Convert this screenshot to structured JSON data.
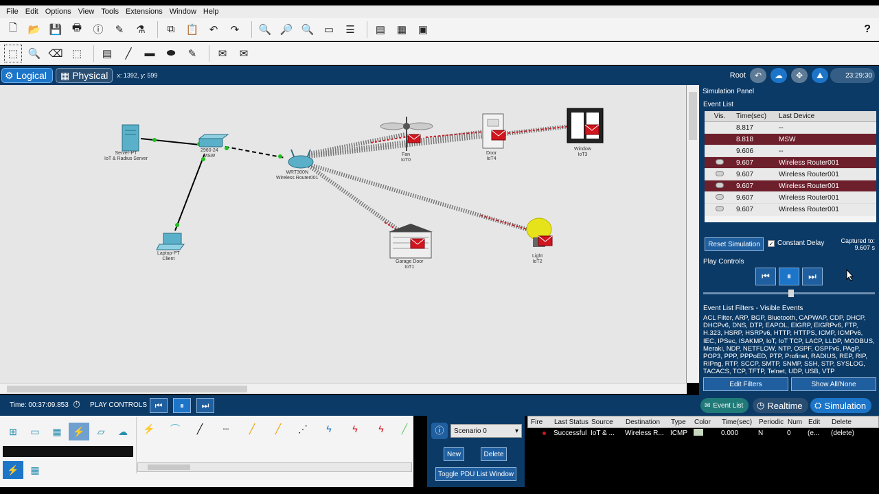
{
  "menu": [
    "File",
    "Edit",
    "Options",
    "View",
    "Tools",
    "Extensions",
    "Window",
    "Help"
  ],
  "viewbar": {
    "logical": "Logical",
    "physical": "Physical",
    "coords": "x: 1392, y: 599",
    "root": "Root",
    "clock": "23:29:30"
  },
  "devices": {
    "server": [
      "Server-PT",
      "IoT & Radius Server"
    ],
    "msw": [
      "2960-24",
      "MSW"
    ],
    "router": [
      "WRT300N",
      "Wireless Router001"
    ],
    "fan": [
      "Fan",
      "IoT0"
    ],
    "door": [
      "Door",
      "IoT4"
    ],
    "window": [
      "Window",
      "IoT3"
    ],
    "laptop": [
      "Laptop-PT",
      "Client"
    ],
    "garage": [
      "Garage Door",
      "IoT1"
    ],
    "light": [
      "Light",
      "IoT2"
    ]
  },
  "sim_panel": {
    "title": "Simulation Panel",
    "event_list": "Event List",
    "columns": [
      "Vis.",
      "Time(sec)",
      "Last Device"
    ],
    "events": [
      {
        "vis": false,
        "time": "8.817",
        "device": "--",
        "hl": false
      },
      {
        "vis": false,
        "time": "8.818",
        "device": "MSW",
        "hl": true
      },
      {
        "vis": false,
        "time": "9.606",
        "device": "--",
        "hl": false
      },
      {
        "vis": true,
        "time": "9.607",
        "device": "Wireless Router001",
        "hl": true
      },
      {
        "vis": true,
        "time": "9.607",
        "device": "Wireless Router001",
        "hl": false
      },
      {
        "vis": true,
        "time": "9.607",
        "device": "Wireless Router001",
        "hl": true
      },
      {
        "vis": true,
        "time": "9.607",
        "device": "Wireless Router001",
        "hl": false
      },
      {
        "vis": true,
        "time": "9.607",
        "device": "Wireless Router001",
        "hl": false
      }
    ],
    "reset": "Reset Simulation",
    "constant_delay": "Constant Delay",
    "captured_label": "Captured to:",
    "captured_value": "9.607 s",
    "play_controls": "Play Controls",
    "filters_title": "Event List Filters - Visible Events",
    "filters_text": "ACL Filter, ARP, BGP, Bluetooth, CAPWAP, CDP, DHCP, DHCPv6, DNS, DTP, EAPOL, EIGRP, EIGRPv6, FTP, H.323, HSRP, HSRPv6, HTTP, HTTPS, ICMP, ICMPv6, IEC, IPSec, ISAKMP, IoT, IoT TCP, LACP, LLDP, MODBUS, Meraki, NDP, NETFLOW, NTP, OSPF, OSPFv6, PAgP, POP3, PPP, PPPoED, PTP, Profinet, RADIUS, REP, RIP, RIPng, RTP, SCCP, SMTP, SNMP, SSH, STP, SYSLOG, TACACS, TCP, TFTP, Telnet, UDP, USB, VTP",
    "edit_filters": "Edit Filters",
    "show_all": "Show All/None"
  },
  "bottom": {
    "time": "Time: 00:37:09.853",
    "play_controls": "PLAY CONTROLS",
    "event_list": "Event List",
    "realtime": "Realtime",
    "simulation": "Simulation"
  },
  "scenario": {
    "selected": "Scenario 0",
    "new": "New",
    "delete": "Delete",
    "toggle": "Toggle PDU List Window"
  },
  "pdu": {
    "columns": [
      "Fire",
      "Last Status",
      "Source",
      "Destination",
      "Type",
      "Color",
      "Time(sec)",
      "Periodic",
      "Num",
      "Edit",
      "Delete"
    ],
    "rows": [
      [
        "",
        "Successful",
        "IoT & ...",
        "Wireless R...",
        "ICMP",
        "",
        "0.000",
        "N",
        "0",
        "(e...",
        "(delete)"
      ]
    ]
  },
  "colors": {
    "panel_blue": "#0c3a66",
    "highlight_row": "#6e1f2c",
    "envelope_red": "#d0151e"
  }
}
